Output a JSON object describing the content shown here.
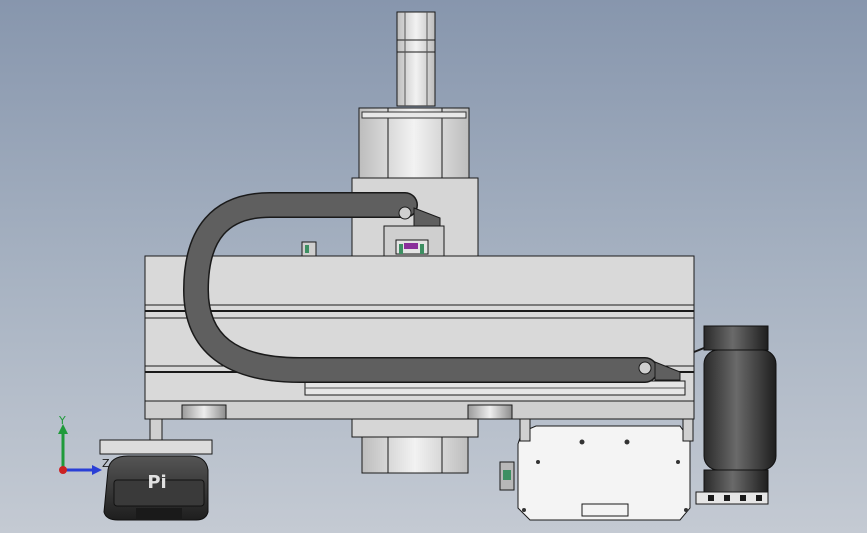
{
  "viewport": {
    "background_top": "#8796ad",
    "background_bottom": "#c4cad3"
  },
  "model": {
    "logo_text": "Pi",
    "body_color": "#d9d9d9",
    "outline_color": "#1a1a1a",
    "cable_chain_color": "#5f5f5f",
    "accent_purple": "#8a2f9a",
    "accent_green": "#3d8f62"
  },
  "triad": {
    "y_label": "Y",
    "z_label": "Z",
    "x_color": "#2a3fd6",
    "y_color": "#1f9a3a",
    "z_color": "#cc2222"
  }
}
